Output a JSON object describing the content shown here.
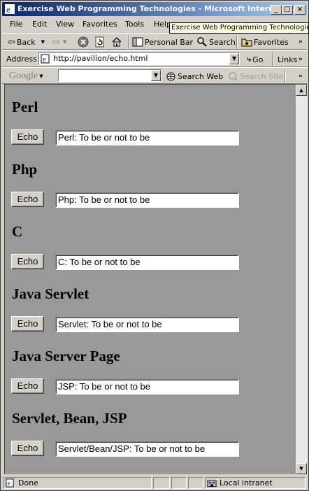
{
  "window": {
    "title": "Exercise Web Programming Technologies - Microsoft Internet ...",
    "tooltip": "Exercise Web Programming Technologies"
  },
  "menu": [
    "File",
    "Edit",
    "View",
    "Favorites",
    "Tools",
    "Help"
  ],
  "toolbar": {
    "back_label": "Back",
    "personal_bar_label": "Personal Bar",
    "search_label": "Search",
    "favorites_label": "Favorites"
  },
  "address": {
    "label": "Address",
    "url": "http://pavilion/echo.html",
    "go_label": "Go",
    "links_label": "Links"
  },
  "google": {
    "logo": "Google",
    "search_web_label": "Search Web",
    "search_site_label": "Search Site",
    "query": ""
  },
  "sections": [
    {
      "heading": "Perl",
      "button": "Echo",
      "output": "Perl: To be or not to be"
    },
    {
      "heading": "Php",
      "button": "Echo",
      "output": "Php: To be or not to be"
    },
    {
      "heading": "C",
      "button": "Echo",
      "output": "C: To be or not to be"
    },
    {
      "heading": "Java Servlet",
      "button": "Echo",
      "output": "Servlet: To be or not to be"
    },
    {
      "heading": "Java Server Page",
      "button": "Echo",
      "output": "JSP: To be or not to be"
    },
    {
      "heading": "Servlet, Bean, JSP",
      "button": "Echo",
      "output": "Servlet/Bean/JSP: To be or not to be"
    }
  ],
  "status": {
    "text": "Done",
    "zone": "Local intranet"
  }
}
